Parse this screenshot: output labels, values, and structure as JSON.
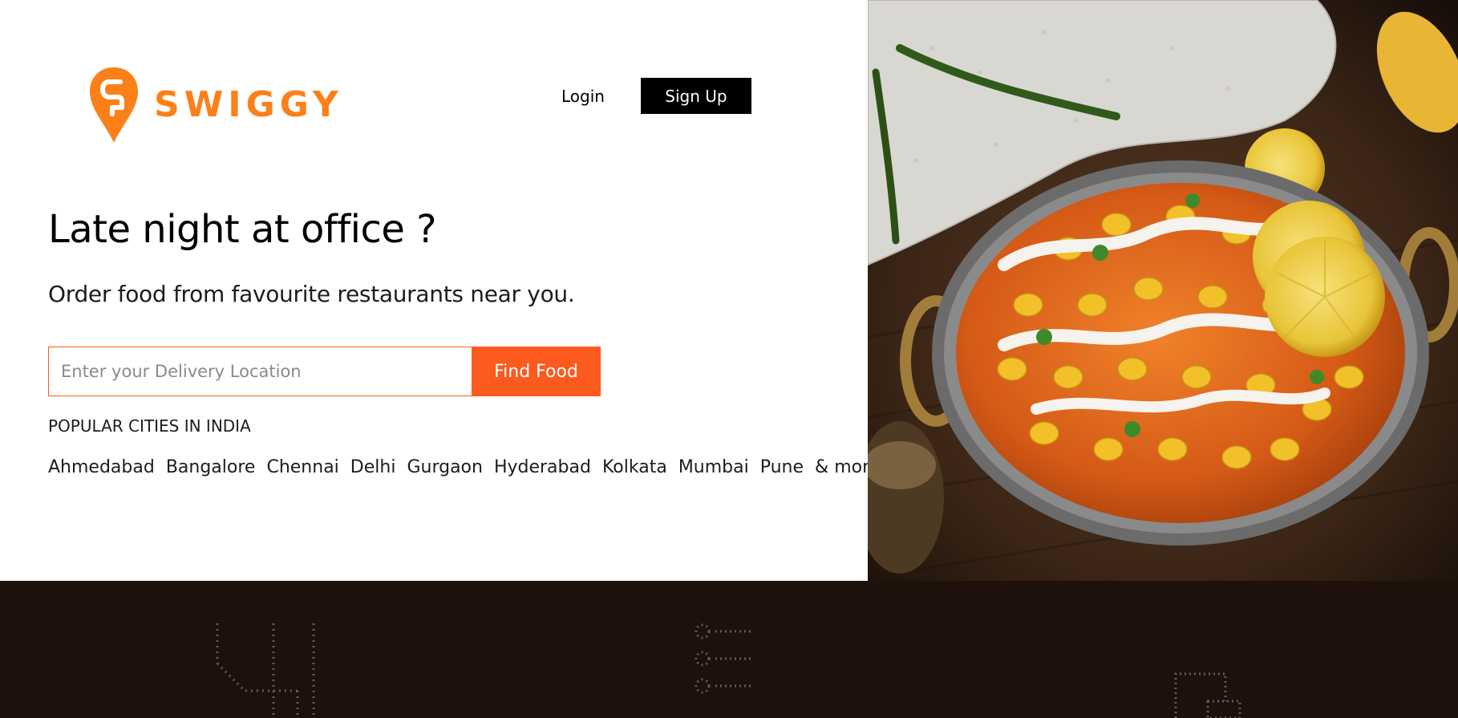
{
  "brand": {
    "name": "SWIGGY",
    "color": "#fc8019"
  },
  "nav": {
    "login_label": "Login",
    "signup_label": "Sign Up"
  },
  "hero": {
    "headline": "Late night at office ?",
    "subheadline": "Order food from favourite restaurants near you."
  },
  "search": {
    "placeholder": "Enter your Delivery Location",
    "value": "",
    "button_label": "Find Food",
    "accent": "#fc5a1e"
  },
  "popular": {
    "title": "POPULAR CITIES IN INDIA",
    "cities": [
      "Ahmedabad",
      "Bangalore",
      "Chennai",
      "Delhi",
      "Gurgaon",
      "Hyderabad",
      "Kolkata",
      "Mumbai",
      "Pune"
    ],
    "more_label": "& more."
  },
  "icons": {
    "logo": "swiggy-pin-logo",
    "footer_icons": [
      "order-icon",
      "list-icon",
      "delivery-icon"
    ]
  },
  "colors": {
    "footer_background": "#1e110b",
    "image_background": "#2a1d14"
  }
}
